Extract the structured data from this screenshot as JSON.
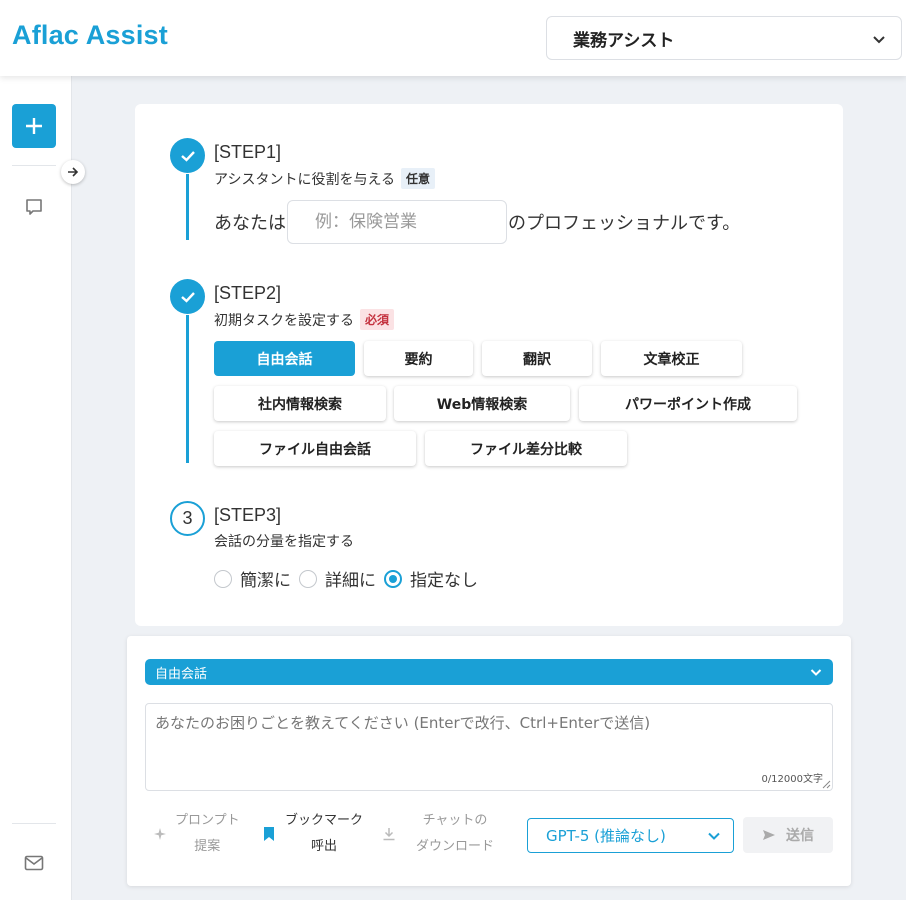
{
  "header": {
    "app_title": "Aflac Assist",
    "mode_select": "業務アシスト"
  },
  "steps": {
    "step1": {
      "title": "[STEP1]",
      "desc": "アシスタントに役割を与える",
      "badge": "任意",
      "prefix": "あなたは",
      "placeholder": "例：保険営業",
      "suffix": "のプロフェッショナルです。"
    },
    "step2": {
      "title": "[STEP2]",
      "desc": "初期タスクを設定する",
      "badge": "必須",
      "tasks": [
        "自由会話",
        "要約",
        "翻訳",
        "文章校正",
        "社内情報検索",
        "Web情報検索",
        "パワーポイント作成",
        "ファイル自由会話",
        "ファイル差分比較"
      ],
      "selected_task": "自由会話"
    },
    "step3": {
      "number": "3",
      "title": "[STEP3]",
      "desc": "会話の分量を指定する",
      "options": [
        "簡潔に",
        "詳細に",
        "指定なし"
      ],
      "selected_option": "指定なし"
    }
  },
  "composer": {
    "task_select": "自由会話",
    "placeholder": "あなたのお困りごとを教えてください (Enterで改行、Ctrl+Enterで送信)",
    "char_count": "0/12000文字",
    "tools": {
      "prompt_line1": "プロンプト",
      "prompt_line2": "提案",
      "bookmark_line1": "ブックマーク",
      "bookmark_line2": "呼出",
      "download_line1": "チャットの",
      "download_line2": "ダウンロード"
    },
    "model": "GPT-5 (推論なし)",
    "send_label": "送信"
  },
  "colors": {
    "accent": "#1aa0d6",
    "required_badge": "#c4323f"
  }
}
